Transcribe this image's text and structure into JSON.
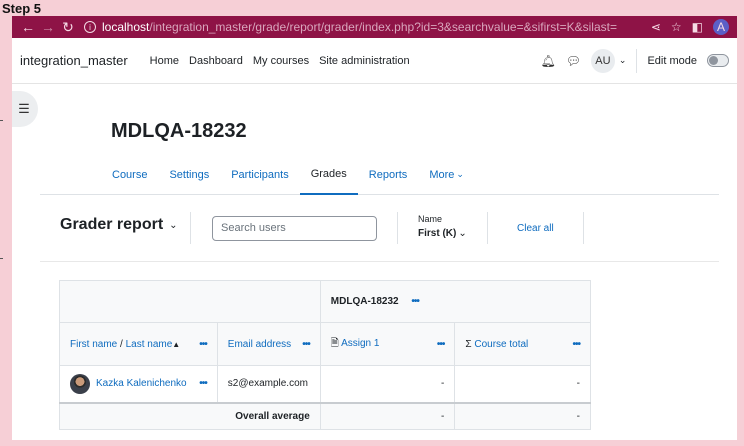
{
  "step_label": "Step 5",
  "browser": {
    "url_host": "localhost",
    "url_path": "/integration_master/grade/report/grader/index.php?id=3&searchvalue=&sifirst=K&silast=",
    "profile_initial": "A"
  },
  "navbar": {
    "site_name": "integration_master",
    "items": [
      "Home",
      "Dashboard",
      "My courses",
      "Site administration"
    ],
    "user_initials": "AU",
    "edit_mode_label": "Edit mode"
  },
  "page": {
    "heading": "MDLQA-18232"
  },
  "secondary_nav": {
    "items": [
      "Course",
      "Settings",
      "Participants",
      "Grades",
      "Reports",
      "More"
    ],
    "active": "Grades"
  },
  "report": {
    "title": "Grader report",
    "search_placeholder": "Search users",
    "name_filter_label": "Name",
    "name_filter_value": "First (K)",
    "clear_all": "Clear all"
  },
  "table": {
    "course_header": "MDLQA-18232",
    "col_name_first": "First name",
    "col_name_sep": " / ",
    "col_name_last": "Last name",
    "col_email": "Email address",
    "col_assign": "Assign 1",
    "col_total": "Course total",
    "rows": [
      {
        "name": "Kazka Kalenichenko",
        "email": "s2@example.com",
        "assign": "-",
        "total": "-"
      }
    ],
    "overall_label": "Overall average",
    "overall_assign": "-",
    "overall_total": "-"
  }
}
